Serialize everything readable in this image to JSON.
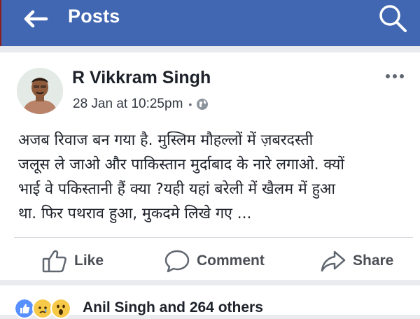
{
  "header": {
    "title": "Posts",
    "back_icon": "back-arrow-icon",
    "search_icon": "search-icon",
    "color": "#4267b2"
  },
  "post": {
    "author": "R Vikkram Singh",
    "timestamp": "28 Jan at 10:25pm",
    "separator": "•",
    "privacy_icon": "globe-icon",
    "text_lines": [
      "अजब रिवाज बन गया है. मुस्लिम मौहल्लों में ज़बरदस्ती",
      "जलूस ले जाओ और पाकिस्तान मुर्दाबाद के नारे लगाओ. क्यों",
      "भाई वे पकिस्तानी हैं क्या ?यही यहां बरेली में खैलम में हुआ",
      "था. फिर पथराव हुआ, मुकदमे लिखे गए ..."
    ]
  },
  "actions": {
    "like": "Like",
    "comment": "Comment",
    "share": "Share"
  },
  "reactions": {
    "summary": "Anil Singh and 264 others",
    "icons": [
      "like-reaction-icon",
      "sad-reaction-icon",
      "wow-reaction-icon"
    ]
  }
}
